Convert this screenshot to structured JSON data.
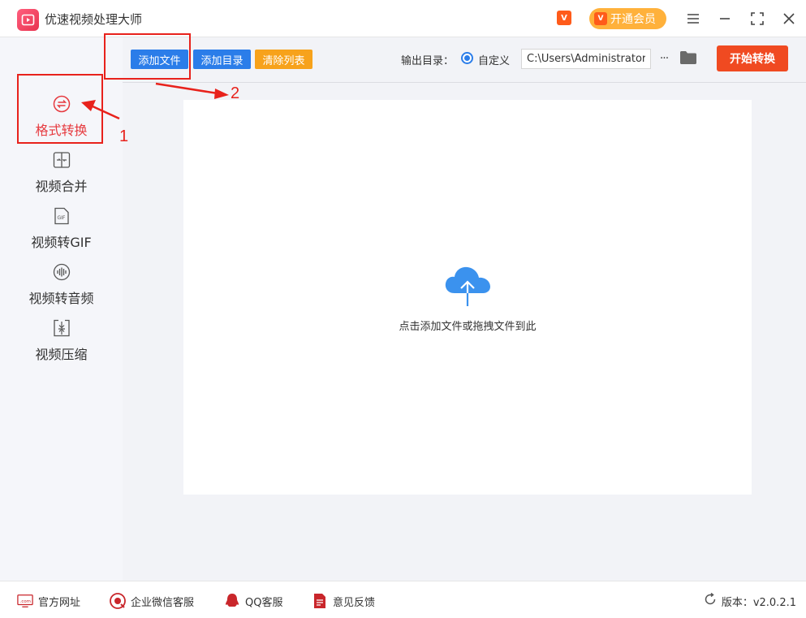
{
  "app": {
    "title": "优速视频处理大师"
  },
  "header": {
    "vip_badge": "V",
    "vip_button_label": "开通会员"
  },
  "sidebar": {
    "items": [
      {
        "label": "格式转换",
        "icon": "format-convert-icon",
        "active": true
      },
      {
        "label": "视频合并",
        "icon": "merge-icon"
      },
      {
        "label": "视频转GIF",
        "icon": "gif-icon"
      },
      {
        "label": "视频转音频",
        "icon": "audio-icon"
      },
      {
        "label": "视频压缩",
        "icon": "compress-icon"
      }
    ]
  },
  "toolbar": {
    "add_file": "添加文件",
    "add_folder": "添加目录",
    "clear_list": "清除列表",
    "output_label": "输出目录：",
    "custom_label": "自定义",
    "output_path": "C:\\Users\\Administrator\\",
    "more": "···",
    "start": "开始转换"
  },
  "dropzone": {
    "hint": "点击添加文件或拖拽文件到此"
  },
  "footer": {
    "links": [
      {
        "label": "官方网址",
        "icon": "website-icon"
      },
      {
        "label": "企业微信客服",
        "icon": "wechat-icon"
      },
      {
        "label": "QQ客服",
        "icon": "qq-icon"
      },
      {
        "label": "意见反馈",
        "icon": "feedback-icon"
      }
    ],
    "version": "版本：v2.0.2.1"
  },
  "annotations": {
    "step1": "1",
    "step2": "2"
  },
  "colors": {
    "accent_blue": "#2b7de9",
    "accent_orange": "#f7a21b",
    "start_red": "#f04a21",
    "annotation_red": "#e8221c",
    "active_red": "#e6393e"
  }
}
